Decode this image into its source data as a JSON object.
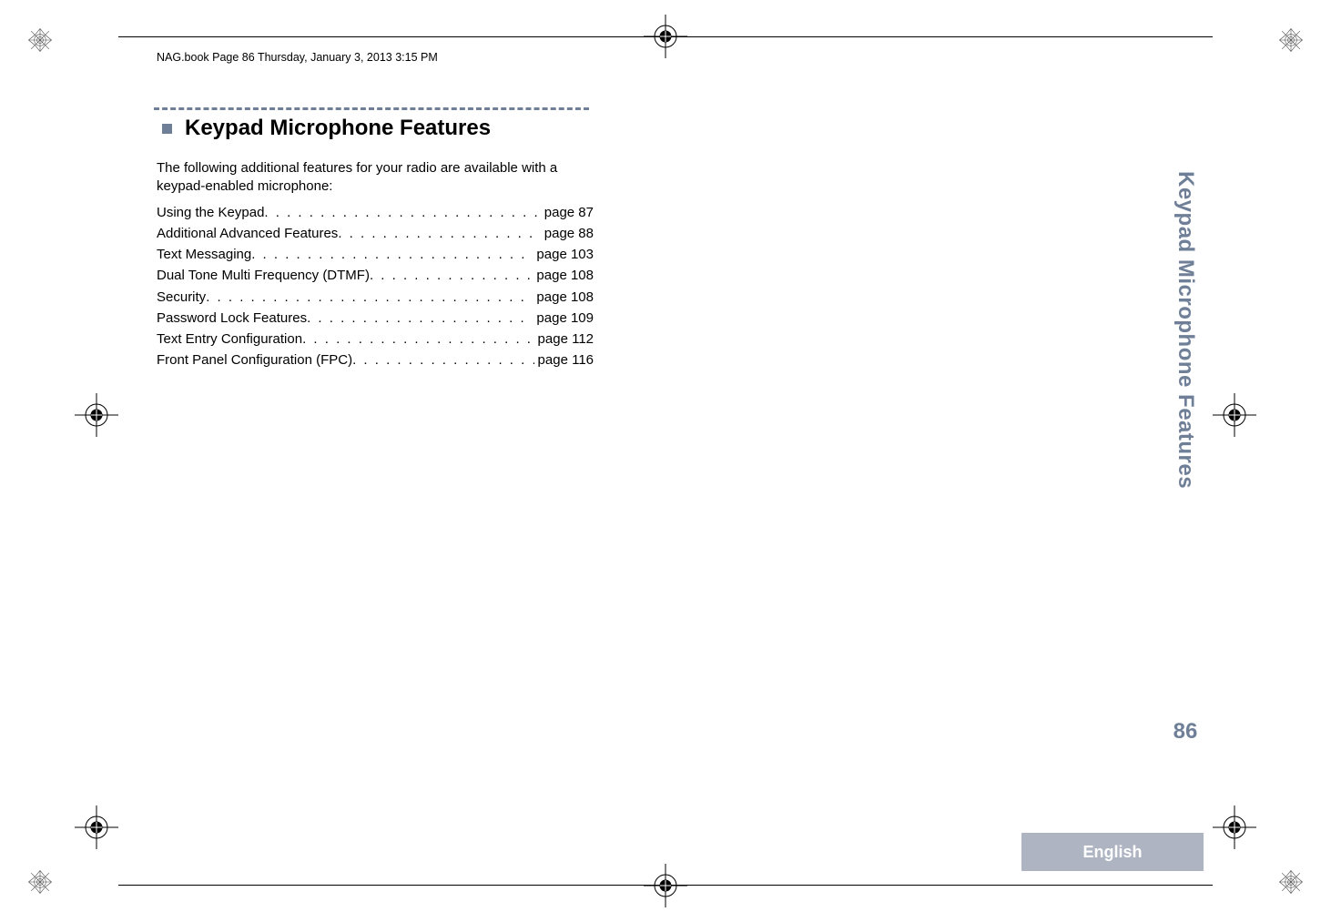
{
  "running_header": "NAG.book  Page 86  Thursday, January 3, 2013  3:15 PM",
  "section": {
    "title": "Keypad Microphone Features",
    "intro": "The following additional features for your radio are available with a keypad-enabled microphone:"
  },
  "toc": [
    {
      "label": "Using the Keypad",
      "page": "page 87"
    },
    {
      "label": "Additional Advanced Features",
      "page": "page 88"
    },
    {
      "label": "Text Messaging",
      "page": "page 103"
    },
    {
      "label": "Dual Tone Multi Frequency (DTMF)",
      "page": "page 108"
    },
    {
      "label": "Security",
      "page": "page 108"
    },
    {
      "label": "Password Lock Features",
      "page": "page 109"
    },
    {
      "label": "Text Entry Configuration",
      "page": "page 112"
    },
    {
      "label": "Front Panel Configuration (FPC)",
      "page": "page 116"
    }
  ],
  "side_tab": "Keypad Microphone Features",
  "page_number": "86",
  "language": "English"
}
